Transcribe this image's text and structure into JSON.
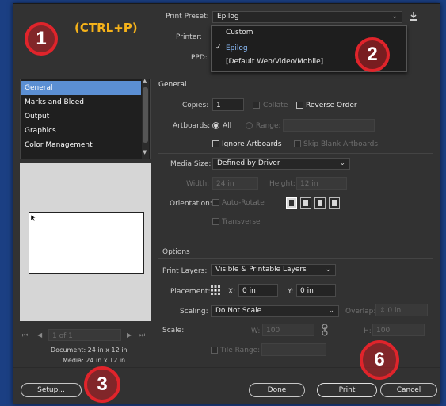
{
  "annotation": {
    "shortcut": "(CTRL+P)",
    "step1": "1",
    "step2": "2",
    "step3": "3",
    "step6": "6",
    "color": "#e0242b"
  },
  "header": {
    "print_preset_label": "Print Preset:",
    "print_preset_value": "Epilog",
    "printer_label": "Printer:",
    "ppd_label": "PPD:"
  },
  "preset_dropdown": {
    "options": [
      "Custom",
      "Epilog",
      "[Default Web/Video/Mobile]"
    ],
    "selected": "Epilog"
  },
  "sidebar": {
    "items": [
      "General",
      "Marks and Bleed",
      "Output",
      "Graphics",
      "Color Management"
    ],
    "selected": "General"
  },
  "preview": {
    "page_indicator": "1 of 1",
    "document_label": "Document: 24 in x 12 in",
    "media_label": "Media: 24 in x 12 in"
  },
  "general": {
    "section_title": "General",
    "copies_label": "Copies:",
    "copies_value": "1",
    "collate_label": "Collate",
    "reverse_order_label": "Reverse Order",
    "artboards_label": "Artboards:",
    "all_label": "All",
    "range_label": "Range:",
    "ignore_artboards_label": "Ignore Artboards",
    "skip_blank_label": "Skip Blank Artboards"
  },
  "media": {
    "media_size_label": "Media Size:",
    "media_size_value": "Defined by Driver",
    "width_label": "Width:",
    "width_value": "24 in",
    "height_label": "Height:",
    "height_value": "12 in",
    "orientation_label": "Orientation:",
    "auto_rotate_label": "Auto-Rotate",
    "transverse_label": "Transverse"
  },
  "options": {
    "section_title": "Options",
    "print_layers_label": "Print Layers:",
    "print_layers_value": "Visible & Printable Layers",
    "placement_label": "Placement:",
    "x_label": "X:",
    "x_value": "0 in",
    "y_label": "Y:",
    "y_value": "0 in",
    "scaling_label": "Scaling:",
    "scaling_value": "Do Not Scale",
    "overlap_label": "Overlap:",
    "overlap_value": "0 in",
    "scale_label": "Scale:",
    "w_label": "W:",
    "w_value": "100",
    "h_label": "H:",
    "h_value": "100",
    "tile_range_label": "Tile Range:"
  },
  "footer": {
    "setup_label": "Setup...",
    "done_label": "Done",
    "print_label": "Print",
    "cancel_label": "Cancel"
  }
}
